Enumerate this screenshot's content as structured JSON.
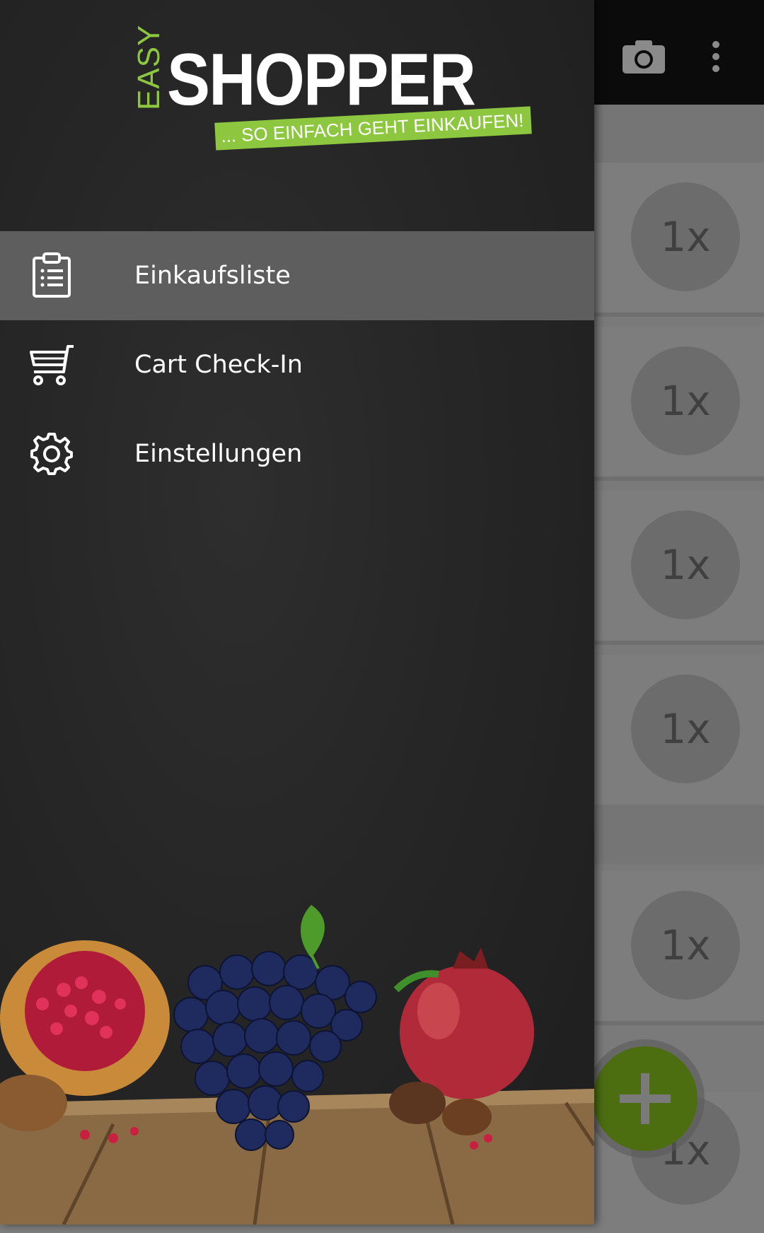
{
  "app": {
    "toolbar": {
      "camera_icon": "camera-icon",
      "overflow_icon": "more-vert-icon"
    },
    "rows": [
      {
        "quantity": "1x"
      },
      {
        "quantity": "1x"
      },
      {
        "quantity": "1x"
      },
      {
        "quantity": "1x"
      },
      {
        "quantity": "1x"
      },
      {
        "quantity": "1x"
      }
    ],
    "fab_icon": "plus-icon"
  },
  "drawer": {
    "logo": {
      "easy": "EASY",
      "shopper": "SHOPPER",
      "tagline": "... SO EINFACH GEHT EINKAUFEN!"
    },
    "items": [
      {
        "label": "Einkaufsliste",
        "icon": "clipboard-list-icon",
        "active": true
      },
      {
        "label": "Cart Check-In",
        "icon": "cart-icon",
        "active": false
      },
      {
        "label": "Einstellungen",
        "icon": "gear-icon",
        "active": false
      }
    ]
  },
  "colors": {
    "brand_green": "#8dc63f",
    "fab_green": "#4c6e10",
    "drawer_bg": "#262626",
    "active_item_bg": "#5e5e5e"
  }
}
